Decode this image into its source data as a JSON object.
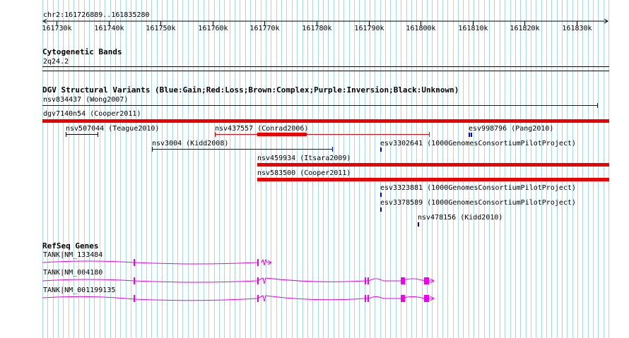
{
  "ruler": {
    "position_label": "chr2:161726889..161835280",
    "ticks": [
      "161730k",
      "161740k",
      "161750k",
      "161760k",
      "161770k",
      "161780k",
      "161790k",
      "161800k",
      "161810k",
      "161820k",
      "161830k"
    ]
  },
  "cytoband": {
    "title": "Cytogenetic Bands",
    "band": "2q24.2"
  },
  "dgv": {
    "title": "DGV Structural Variants (Blue:Gain;Red:Loss;Brown:Complex;Purple:Inversion;Black:Unknown)",
    "variants": [
      {
        "name": "nsv834437 (Wong2007)",
        "type": "gain"
      },
      {
        "name": "dgv7140n54 (Cooper2011)",
        "type": "loss"
      },
      {
        "name": "nsv507044 (Teague2010)",
        "type": "unknown"
      },
      {
        "name": "nsv437557 (Conrad2006)",
        "type": "loss"
      },
      {
        "name": "esv998796 (Pang2010)",
        "type": "gain"
      },
      {
        "name": "nsv3004 (Kidd2008)",
        "type": "gain"
      },
      {
        "name": "esv3302641 (1000GenomesConsortiumPilotProject)",
        "type": "gain"
      },
      {
        "name": "nsv459934 (Itsara2009)",
        "type": "loss"
      },
      {
        "name": "nsv583500 (Cooper2011)",
        "type": "loss"
      },
      {
        "name": "esv3323881 (1000GenomesConsortiumPilotProject)",
        "type": "gain"
      },
      {
        "name": "esv3378589 (1000GenomesConsortiumPilotProject)",
        "type": "gain"
      },
      {
        "name": "nsv478156 (Kidd2010)",
        "type": "gain"
      }
    ]
  },
  "refseq": {
    "title": "RefSeq Genes",
    "genes": [
      {
        "name": "TANK|NM_133484"
      },
      {
        "name": "TANK|NM_004180"
      },
      {
        "name": "TANK|NM_001199135"
      }
    ]
  },
  "colors": {
    "grid": "#a8d8e8",
    "gain": "#0000cc",
    "loss": "#ee0000",
    "unknown": "#000000",
    "gene": "#ee00ee"
  }
}
